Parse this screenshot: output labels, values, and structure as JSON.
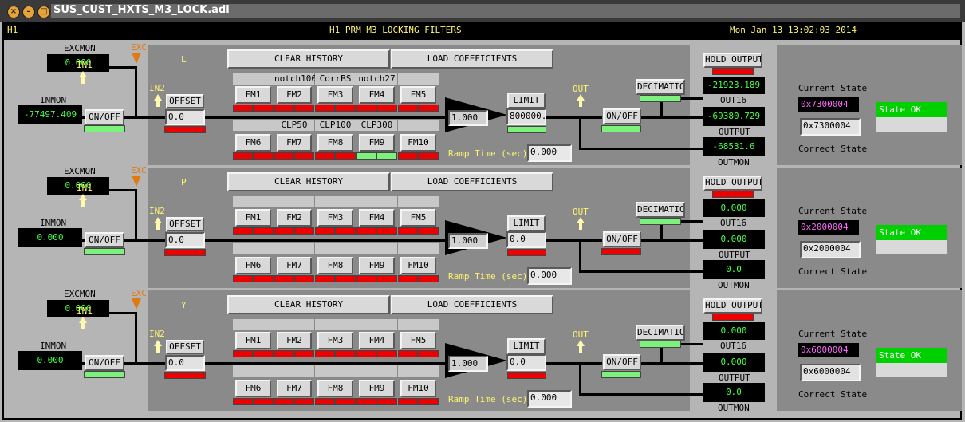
{
  "window": {
    "title": "SUS_CUST_HXTS_M3_LOCK.adl"
  },
  "header": {
    "ifo": "H1",
    "title": "H1 PRM M3 LOCKING FILTERS",
    "datetime": "Mon Jan 13 13:02:03 2014"
  },
  "common": {
    "excmon_label": "EXCMON",
    "exc_label": "EXC",
    "inmon_label": "INMON",
    "in1_label": "IN1",
    "in2_label": "IN2",
    "onoff_label": "ON/OFF",
    "offset_label": "OFFSET",
    "clear_history": "CLEAR HISTORY",
    "load_coefficients": "LOAD COEFFICIENTS",
    "limit_label": "LIMIT",
    "out_label": "OUT",
    "ramp_label": "Ramp Time (sec):",
    "hold_output": "HOLD OUTPUT",
    "decimation": "DECIMATION",
    "out16_label": "OUT16",
    "output_label": "OUTPUT",
    "outmon_label": "OUTMON",
    "current_state_label": "Current State",
    "correct_state_label": "Correct State"
  },
  "colors": {
    "led_on": "#7cf27c",
    "led_off": "#ee0000",
    "monitor_text": "#47ff47",
    "state_ok": "#00d000",
    "exc_orange": "#e07a10"
  },
  "banks": [
    {
      "name": "L",
      "excmon": "0.000",
      "inmon": "-77497.409",
      "offset": "0.0",
      "fm_top": [
        "FM1",
        "FM2",
        "FM3",
        "FM4",
        "FM5"
      ],
      "fm_top_names": [
        "",
        "notch100",
        "CorrBS",
        "notch27",
        ""
      ],
      "fm_bot": [
        "FM6",
        "FM7",
        "FM8",
        "FM9",
        "FM10"
      ],
      "fm_bot_names": [
        "",
        "CLP50",
        "CLP100",
        "CLP300",
        ""
      ],
      "fm_bot_active": [
        false,
        false,
        false,
        true,
        false
      ],
      "gain": "1.000",
      "limit": "800000.",
      "ramp": "0.000",
      "out16": "-21923.189",
      "output": "-69380.729",
      "outmon": "-68531.6",
      "input_on": true,
      "offset_on": false,
      "output_onoff_on": true,
      "limit_on": true,
      "decimation_on": true,
      "current_state": "0x7300004",
      "correct_state": "0x7300004",
      "state_status": "State OK"
    },
    {
      "name": "P",
      "excmon": "0.000",
      "inmon": "0.000",
      "offset": "0.0",
      "fm_top": [
        "FM1",
        "FM2",
        "FM3",
        "FM4",
        "FM5"
      ],
      "fm_top_names": [
        "",
        "",
        "",
        "",
        ""
      ],
      "fm_bot": [
        "FM6",
        "FM7",
        "FM8",
        "FM9",
        "FM10"
      ],
      "fm_bot_names": [
        "",
        "",
        "",
        "",
        ""
      ],
      "fm_bot_active": [
        false,
        false,
        false,
        false,
        false
      ],
      "gain": "1.000",
      "limit": "0.0",
      "ramp": "0.000",
      "out16": "0.000",
      "output": "0.000",
      "outmon": "0.0",
      "input_on": true,
      "offset_on": false,
      "output_onoff_on": false,
      "limit_on": false,
      "decimation_on": true,
      "current_state": "0x2000004",
      "correct_state": "0x2000004",
      "state_status": "State OK"
    },
    {
      "name": "Y",
      "excmon": "0.000",
      "inmon": "0.000",
      "offset": "0.0",
      "fm_top": [
        "FM1",
        "FM2",
        "FM3",
        "FM4",
        "FM5"
      ],
      "fm_top_names": [
        "",
        "",
        "",
        "",
        ""
      ],
      "fm_bot": [
        "FM6",
        "FM7",
        "FM8",
        "FM9",
        "FM10"
      ],
      "fm_bot_names": [
        "",
        "",
        "",
        "",
        ""
      ],
      "fm_bot_active": [
        false,
        false,
        false,
        false,
        false
      ],
      "gain": "1.000",
      "limit": "0.0",
      "ramp": "0.000",
      "out16": "0.000",
      "output": "0.000",
      "outmon": "0.0",
      "input_on": true,
      "offset_on": false,
      "output_onoff_on": true,
      "limit_on": false,
      "decimation_on": true,
      "current_state": "0x6000004",
      "correct_state": "0x6000004",
      "state_status": "State OK"
    }
  ]
}
